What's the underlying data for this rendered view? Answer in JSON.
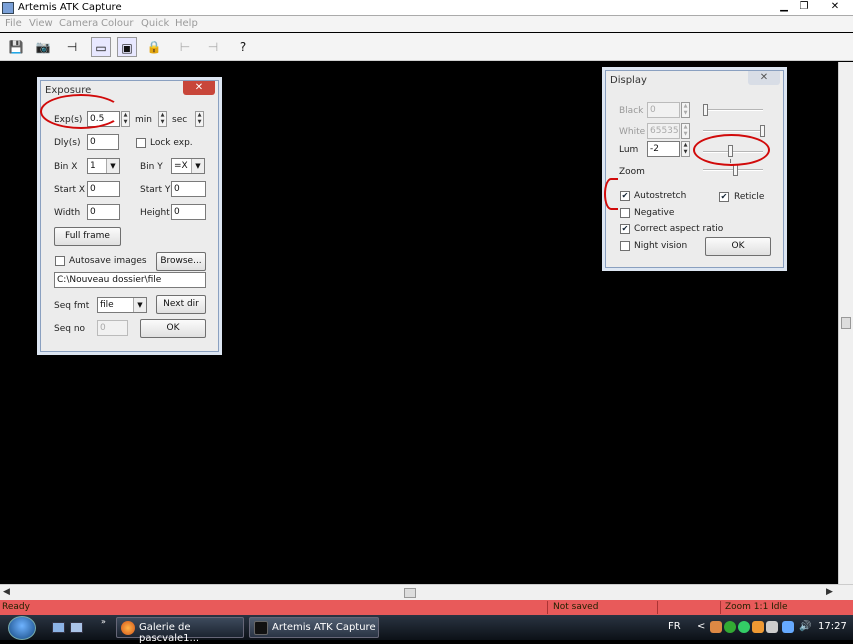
{
  "window": {
    "title": "Artemis ATK Capture",
    "minimize": "▁",
    "maximize": "❐",
    "close": "✕"
  },
  "menu": [
    "File",
    "View",
    "Camera",
    "Colour",
    "Quick",
    "Help"
  ],
  "toolbar": {
    "save_icon": "💾",
    "camera_icon": "📷",
    "pointer_icon": "⊣",
    "frame_icon": "▭",
    "subframe_icon": "▣",
    "lock_icon": "🔒",
    "prev_icon": "⊢",
    "next_icon": "⊣",
    "help_icon": "?"
  },
  "exposure": {
    "title": "Exposure",
    "close": "✕",
    "exp_label": "Exp(s)",
    "exp_value": "0.5",
    "min_label": "min",
    "sec_label": "sec",
    "dly_label": "Dly(s)",
    "dly_value": "0",
    "lock_label": "Lock exp.",
    "binx_label": "Bin X",
    "binx_value": "1",
    "binn_label": "Bin Y",
    "binn_value": "=X",
    "startx_label": "Start X",
    "startx_value": "0",
    "starty_label": "Start Y",
    "starty_value": "0",
    "width_label": "Width",
    "width_value": "0",
    "height_label": "Height",
    "height_value": "0",
    "fullframe": "Full frame",
    "autosave_label": "Autosave images",
    "browse": "Browse...",
    "path": "C:\\Nouveau dossier\\file",
    "seq_label": "Seq fmt",
    "seq_value": "file",
    "nextdir": "Next dir",
    "seqnum_label": "Seq no",
    "seqnum_value": "0",
    "ok": "OK"
  },
  "display": {
    "title": "Display",
    "close": "✕",
    "black_label": "Black",
    "black_value": "0",
    "white_label": "White",
    "white_value": "65535",
    "lum_label": "Lum",
    "lum_value": "-2",
    "zoom_label": "Zoom",
    "autostretch_label": "Autostretch",
    "autostretch_checked": true,
    "reticle_label": "Reticle",
    "reticle_checked": true,
    "negative_label": "Negative",
    "negative_checked": false,
    "aspect_label": "Correct aspect ratio",
    "aspect_checked": true,
    "night_label": "Night vision",
    "night_checked": false,
    "ok": "OK"
  },
  "status": {
    "left": "Ready",
    "middle": "Not saved",
    "right": "Zoom 1:1 Idle"
  },
  "taskbar": {
    "tasks": [
      {
        "label": "Galerie de pascvale1..."
      },
      {
        "label": "Artemis ATK Capture"
      }
    ],
    "lang": "FR",
    "chevron": "<",
    "clock": "17:27"
  }
}
